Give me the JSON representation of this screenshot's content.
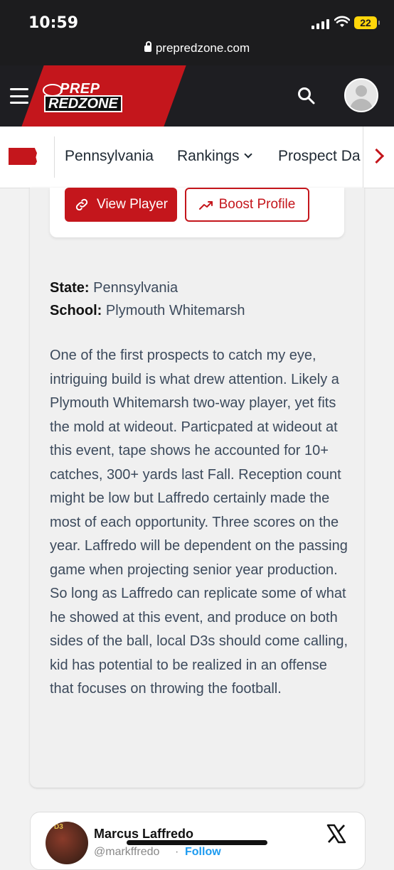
{
  "status_bar": {
    "time": "10:59",
    "battery": "22",
    "url": "prepredzone.com"
  },
  "header": {
    "logo_top": "PREP",
    "logo_bottom": "REDZONE"
  },
  "subnav": {
    "items": [
      "Pennsylvania",
      "Rankings",
      "Prospect Da"
    ]
  },
  "buttons": {
    "view_player": "View Player",
    "boost_profile": "Boost Profile"
  },
  "player": {
    "state_label": "State:",
    "state": "Pennsylvania",
    "school_label": "School:",
    "school": "Plymouth Whitemarsh",
    "bio": "One of the first prospects to catch my eye, intriguing build is what drew attention. Likely a Plymouth Whitemarsh two-way player, yet fits the mold at wideout. Particpated at wideout at this event, tape shows he accounted for 10+ catches, 300+ yards last Fall. Reception count might be low but Laffredo certainly made the most of each opportunity. Three scores on the year. Laffredo will be dependent on the passing game when projecting senior year production. So long as Laffredo can replicate some of what he showed at this event, and produce on both sides of the ball, local D3s should come calling, kid has potential to be realized in an offense that focuses on throwing the football."
  },
  "tweet": {
    "name": "Marcus Laffredo",
    "handle": "@markffredo",
    "dot": "·",
    "follow": "Follow",
    "avatar_text": "D3"
  },
  "colors": {
    "brand_red": "#c4161c",
    "header_dark": "#1e1e22",
    "twitter_blue": "#1d9bf0"
  }
}
